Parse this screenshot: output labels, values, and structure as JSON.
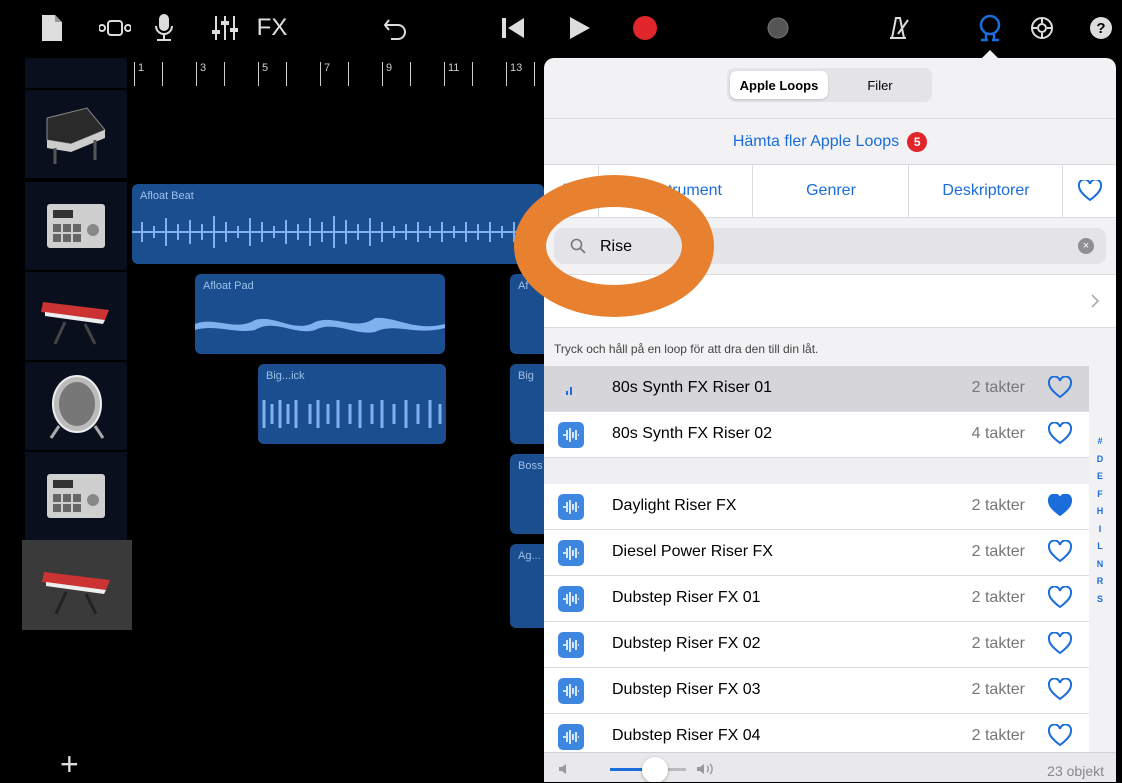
{
  "toolbar": {
    "fx_label": "FX",
    "icons": [
      "document-icon",
      "tracks-view-icon",
      "microphone-icon",
      "mixer-icon",
      "undo-icon",
      "rewind-icon",
      "play-icon",
      "record-icon",
      "metronome-toggle-icon",
      "metronome-icon",
      "loop-browser-icon",
      "settings-icon",
      "help-icon"
    ],
    "record_color": "#e0262b",
    "accent": "#1b6ddb"
  },
  "ruler": {
    "marks": [
      "1",
      "3",
      "5",
      "7",
      "9",
      "11",
      "13"
    ]
  },
  "tracks": [
    {
      "icon": "grand-piano-icon"
    },
    {
      "icon": "drum-machine-icon"
    },
    {
      "icon": "synth-keyboard-icon"
    },
    {
      "icon": "bass-drum-icon"
    },
    {
      "icon": "drum-machine-icon"
    },
    {
      "icon": "synth-keyboard-icon"
    }
  ],
  "regions": [
    {
      "name": "Afloat Beat"
    },
    {
      "name": "Afloat Pad"
    },
    {
      "name": "Big...ick"
    },
    {
      "name": "Af"
    },
    {
      "name": "Big"
    },
    {
      "name": "Boss"
    },
    {
      "name": "Ag..."
    }
  ],
  "add_track": "+",
  "browser": {
    "tabs": [
      "Apple Loops",
      "Filer"
    ],
    "more_loops": "Hämta fler Apple Loops",
    "more_badge": "5",
    "filters": [
      "strument",
      "Genrer",
      "Deskriptorer"
    ],
    "search_value": "Rise",
    "hint": "Tryck och håll på en loop för att dra den till din låt.",
    "loops": [
      {
        "name": "80s Synth FX Riser 01",
        "length": "2 takter",
        "favorite": false,
        "playing": true
      },
      {
        "name": "80s Synth FX Riser 02",
        "length": "4 takter",
        "favorite": false
      },
      {
        "name": "Daylight Riser FX",
        "length": "2 takter",
        "favorite": true
      },
      {
        "name": "Diesel Power Riser FX",
        "length": "2 takter",
        "favorite": false
      },
      {
        "name": "Dubstep Riser FX 01",
        "length": "2 takter",
        "favorite": false
      },
      {
        "name": "Dubstep Riser FX 02",
        "length": "2 takter",
        "favorite": false
      },
      {
        "name": "Dubstep Riser FX 03",
        "length": "2 takter",
        "favorite": false
      },
      {
        "name": "Dubstep Riser FX 04",
        "length": "2 takter",
        "favorite": false
      }
    ],
    "index_letters": [
      "#",
      "D",
      "E",
      "F",
      "H",
      "I",
      "L",
      "N",
      "R",
      "S"
    ],
    "count": "23 objekt"
  },
  "annotation_color": "#e8812f"
}
